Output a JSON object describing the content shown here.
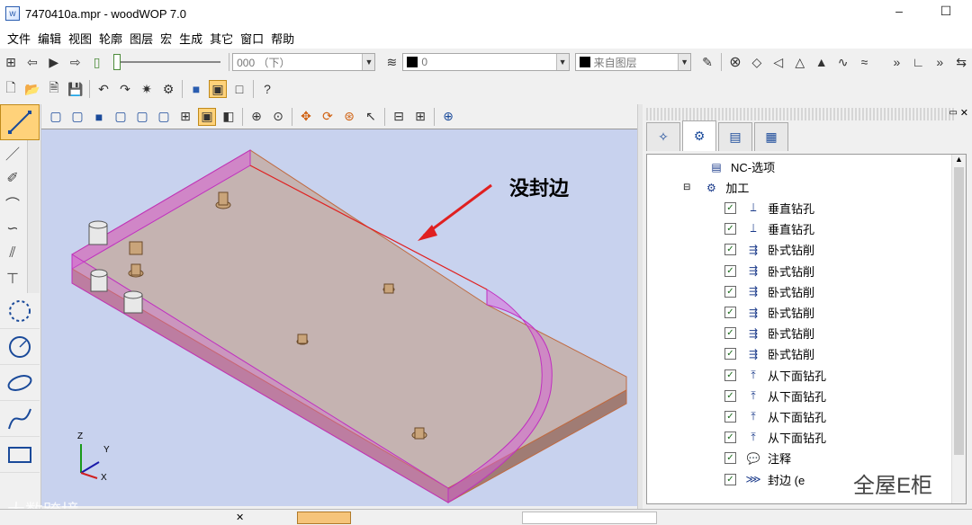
{
  "window": {
    "title": "7470410a.mpr - woodWOP 7.0",
    "minimize": "–",
    "maximize": "☐"
  },
  "menu": [
    "文件",
    "编辑",
    "视图",
    "轮廓",
    "图层",
    "宏",
    "生成",
    "其它",
    "窗口",
    "帮助"
  ],
  "toolbar": {
    "layer_combo": "000  （下）",
    "color_combo": "0",
    "from_layer_combo": "来自图层"
  },
  "annotation": {
    "text": "没封边",
    "color": "#e02020"
  },
  "axes": {
    "x": "X",
    "y": "Y",
    "z": "Z"
  },
  "tree": {
    "root_label": "NC-选项",
    "group_label": "加工",
    "items": [
      {
        "label": "垂直钻孔",
        "icon": "vertical-drill-icon"
      },
      {
        "label": "垂直钻孔",
        "icon": "vertical-drill-icon"
      },
      {
        "label": "卧式钻削",
        "icon": "horizontal-drill-icon"
      },
      {
        "label": "卧式钻削",
        "icon": "horizontal-drill-icon"
      },
      {
        "label": "卧式钻削",
        "icon": "horizontal-drill-icon"
      },
      {
        "label": "卧式钻削",
        "icon": "horizontal-drill-icon"
      },
      {
        "label": "卧式钻削",
        "icon": "horizontal-drill-icon"
      },
      {
        "label": "卧式钻削",
        "icon": "horizontal-drill-icon"
      },
      {
        "label": "从下面钻孔",
        "icon": "bottom-drill-icon"
      },
      {
        "label": "从下面钻孔",
        "icon": "bottom-drill-icon"
      },
      {
        "label": "从下面钻孔",
        "icon": "bottom-drill-icon"
      },
      {
        "label": "从下面钻孔",
        "icon": "bottom-drill-icon"
      },
      {
        "label": "注释",
        "icon": "comment-icon"
      },
      {
        "label": "封边 (e",
        "icon": "edgebanding-icon"
      }
    ]
  },
  "watermarks": {
    "left": "大数跨境",
    "right": "全屋E柜"
  },
  "colors": {
    "viewport_bg": "#c8d2ee",
    "board_fill": "#c4a89c",
    "edge_band": "#d860d8"
  }
}
